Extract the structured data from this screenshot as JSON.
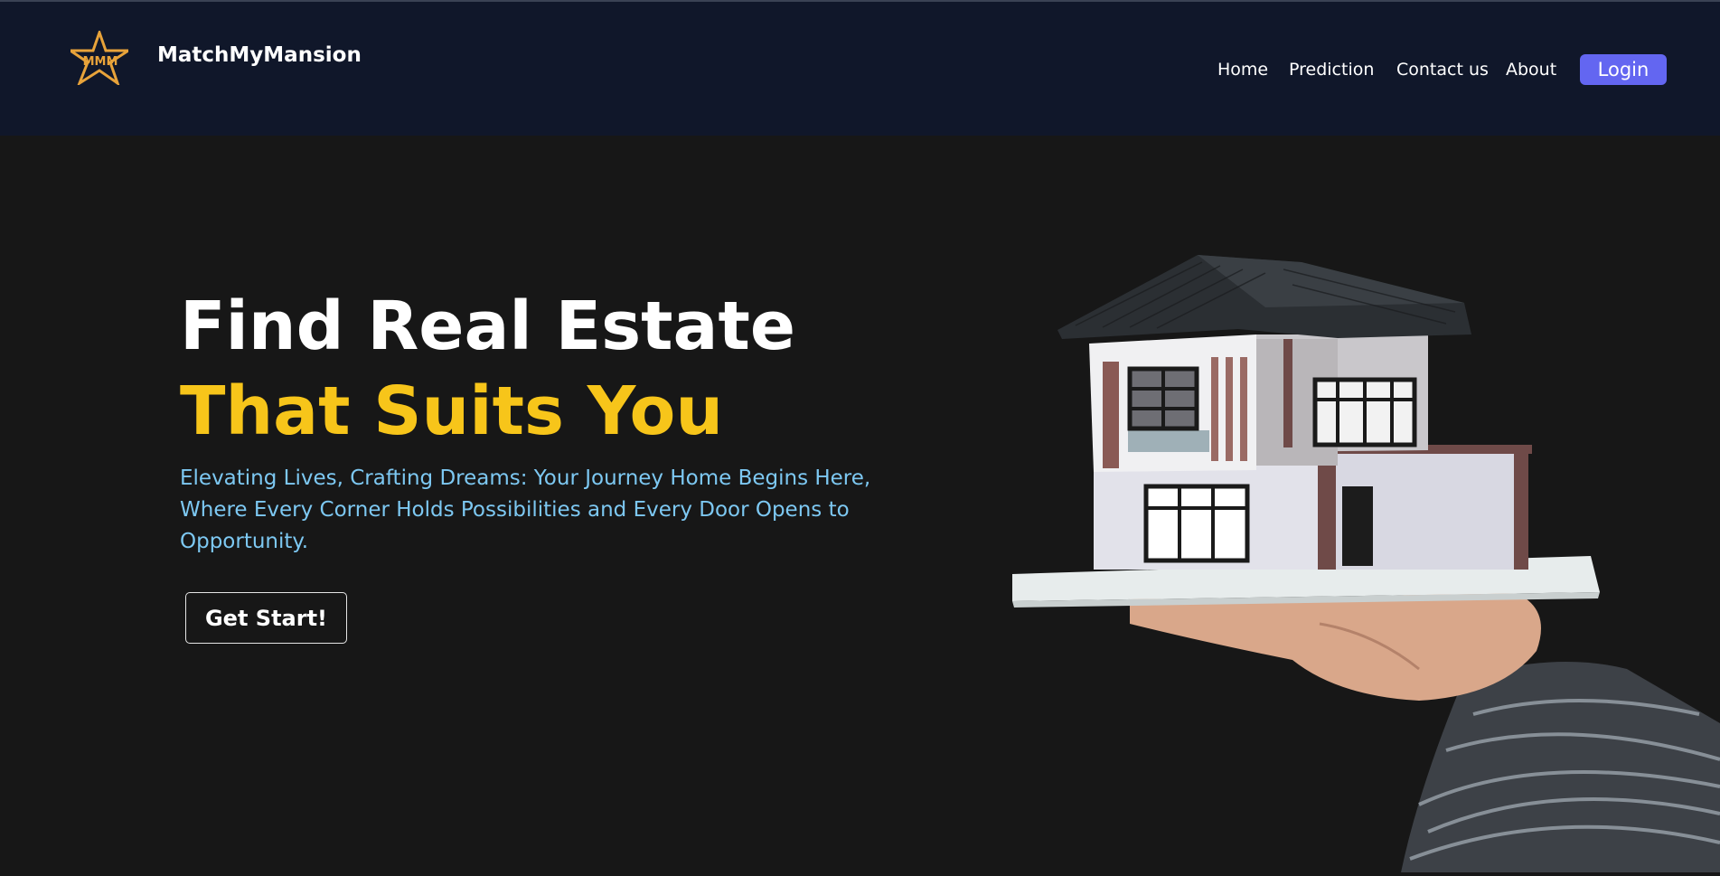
{
  "header": {
    "logo_text": "MMM",
    "brand": "MatchMyMansion",
    "nav": [
      "Home",
      "Prediction",
      "Contact us",
      "About"
    ],
    "login_label": "Login"
  },
  "hero": {
    "title_line1": "Find Real Estate",
    "title_line2": "That Suits You",
    "subtitle": "Elevating Lives, Crafting Dreams: Your Journey Home Begins Here, Where Every Corner Holds Possibilities and Every Door Opens to Opportunity.",
    "cta_label": "Get Start!"
  },
  "colors": {
    "navbar_bg": "#10172a",
    "page_bg": "#171717",
    "accent_yellow": "#f7c51a",
    "subtitle_blue": "#7dc8f2",
    "login_bg": "#6366f1",
    "logo_orange": "#e8a33a"
  },
  "icons": {
    "logo": "star-logo-icon",
    "hero": "house-model-on-hand-image"
  }
}
